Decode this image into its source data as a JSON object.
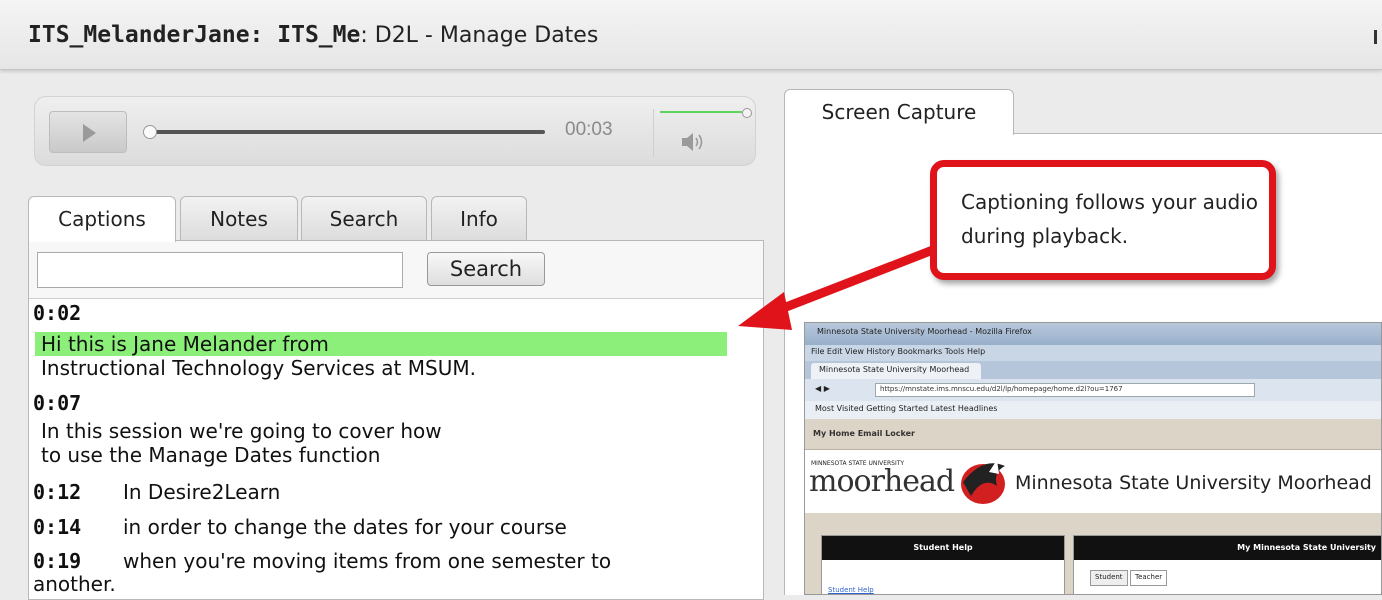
{
  "window": {
    "title_bold": "ITS_MelanderJane: ITS_Me",
    "title_rest": ": D2L - Manage Dates"
  },
  "player": {
    "time": "00:03",
    "progress_fraction": 0.0,
    "volume_fraction": 1.0
  },
  "tabs": [
    {
      "label": "Captions",
      "active": true
    },
    {
      "label": "Notes",
      "active": false
    },
    {
      "label": "Search",
      "active": false
    },
    {
      "label": "Info",
      "active": false
    }
  ],
  "search": {
    "input_value": "",
    "button_label": "Search"
  },
  "captions": [
    {
      "time": "0:02",
      "lines": [
        "Hi this is Jane Melander from",
        "Instructional Technology Services at MSUM."
      ],
      "highlighted": true
    },
    {
      "time": "0:07",
      "lines": [
        "In this session we're going to cover how",
        "to use the Manage Dates function"
      ],
      "highlighted": false
    },
    {
      "time": "0:12",
      "lines": [
        "In Desire2Learn"
      ],
      "highlighted": false
    },
    {
      "time": "0:14",
      "lines": [
        "in order to change the dates for your course"
      ],
      "highlighted": false
    },
    {
      "time": "0:19",
      "lines": [
        "when you're moving items from one semester to",
        "another."
      ],
      "highlighted": false
    }
  ],
  "screen_capture": {
    "tab_label": "Screen Capture",
    "callout_text": "Captioning follows your audio during playback.",
    "callout_color": "#e0131b",
    "browser": {
      "title": "Minnesota State University Moorhead - Mozilla Firefox",
      "menu": "File  Edit  View  History  Bookmarks  Tools  Help",
      "tab": "Minnesota State University Moorhead",
      "url": "https://mnstate.ims.mnscu.edu/d2l/lp/homepage/home.d2l?ou=1767",
      "bookmarks": "Most Visited   Getting Started   Latest Headlines",
      "d2l_nav": "My Home    Email    Locker",
      "brand_small": "MINNESOTA STATE UNIVERSITY",
      "brand_logo": "moorhead",
      "university": "Minnesota State University Moorhead",
      "box1_title": "Student Help",
      "box1_link": "Student Help",
      "box2_title": "My Minnesota State University",
      "box2_tabs": [
        "Student",
        "Teacher"
      ]
    }
  }
}
